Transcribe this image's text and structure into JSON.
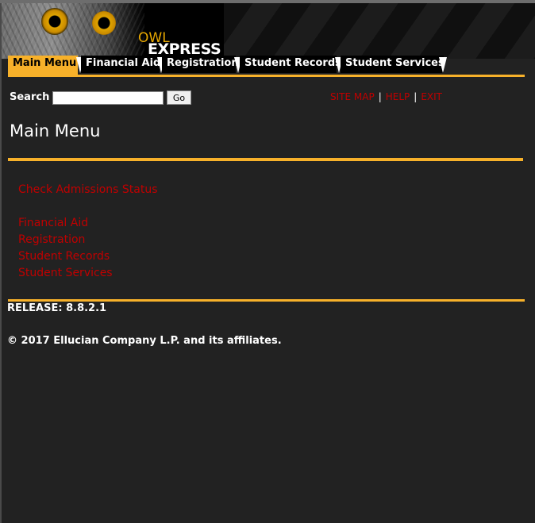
{
  "banner": {
    "logo_owl": "OWL",
    "logo_express": "EXPRESS"
  },
  "tabs": [
    {
      "label": "Main Menu",
      "active": true
    },
    {
      "label": "Financial Aid",
      "active": false
    },
    {
      "label": "Registration",
      "active": false
    },
    {
      "label": "Student Records",
      "active": false
    },
    {
      "label": "Student Services",
      "active": false
    }
  ],
  "search": {
    "label": "Search",
    "value": "",
    "button_label": "Go"
  },
  "util_links": {
    "site_map": "SITE MAP",
    "help": "HELP",
    "exit": "EXIT",
    "separator": "|"
  },
  "page_title": "Main Menu",
  "menu_links": {
    "check_admissions": "Check Admissions Status",
    "financial_aid": "Financial Aid",
    "registration": "Registration",
    "student_records": "Student Records",
    "student_services": "Student Services"
  },
  "footer": {
    "release": "RELEASE: 8.8.2.1",
    "copyright": "© 2017 Ellucian Company L.P. and its affiliates."
  },
  "colors": {
    "accent": "#f7b12a",
    "link": "#c00000",
    "background": "#222222"
  }
}
